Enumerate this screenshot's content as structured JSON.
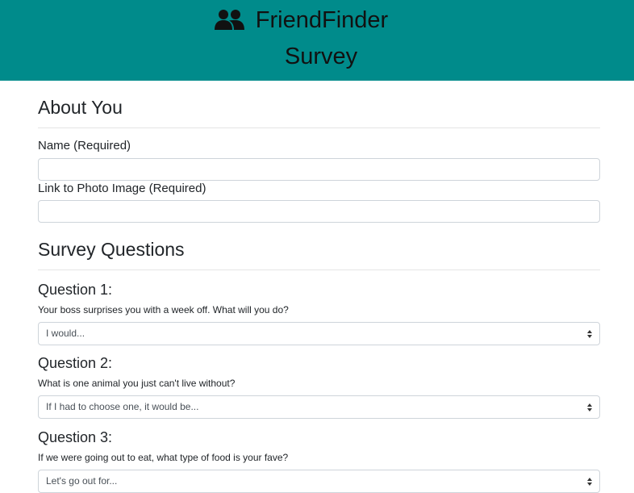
{
  "header": {
    "brand": "FriendFinder",
    "subtitle": "Survey",
    "brand_icon": "users-icon",
    "background": "#008b8b"
  },
  "about": {
    "title": "About You",
    "name_label": "Name (Required)",
    "name_value": "",
    "photo_label": "Link to Photo Image (Required)",
    "photo_value": ""
  },
  "survey": {
    "title": "Survey Questions",
    "questions": [
      {
        "heading": "Question 1:",
        "text": "Your boss surprises you with a week off. What will you do?",
        "selected": "I would..."
      },
      {
        "heading": "Question 2:",
        "text": "What is one animal you just can't live without?",
        "selected": "If I had to choose one, it would be..."
      },
      {
        "heading": "Question 3:",
        "text": "If we were going out to eat, what type of food is your fave?",
        "selected": "Let's go out for..."
      }
    ]
  }
}
